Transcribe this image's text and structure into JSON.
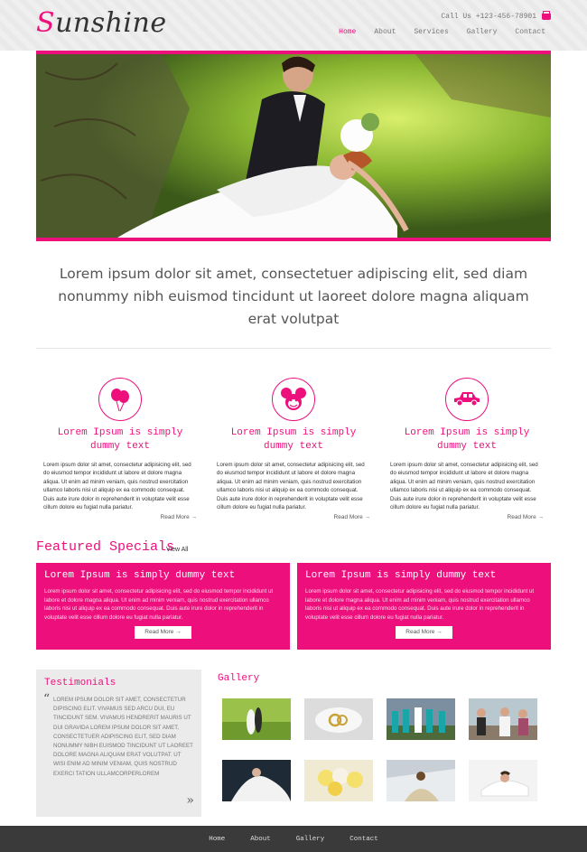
{
  "header": {
    "logo_first": "S",
    "logo_rest": "unshine",
    "call_text": "Call Us +123-456-78901",
    "nav": [
      "Home",
      "About",
      "Services",
      "Gallery",
      "Contact"
    ]
  },
  "lead": "Lorem ipsum dolor sit amet, consectetuer adipiscing elit, sed diam nonummy nibh euismod tincidunt ut laoreet dolore magna aliquam erat volutpat",
  "features": [
    {
      "icon": "balloons-icon",
      "title": "Lorem Ipsum is simply dummy text",
      "text": "Lorem ipsum dolor sit amet, consectetur adipisicing elit, sed do eiusmod tempor incididunt ut labore et dolore magna aliqua. Ut enim ad minim veniam, quis nostrud exercitation ullamco laboris nisi ut aliquip ex ea commodo consequat. Duis aute irure dolor in reprehenderit in voluptate velit esse cillum dolore eu fugiat nulla pariatur.",
      "more": "Read More →"
    },
    {
      "icon": "mouse-icon",
      "title": "Lorem Ipsum is simply dummy text",
      "text": "Lorem ipsum dolor sit amet, consectetur adipisicing elit, sed do eiusmod tempor incididunt ut labore et dolore magna aliqua. Ut enim ad minim veniam, quis nostrud exercitation ullamco laboris nisi ut aliquip ex ea commodo consequat. Duis aute irure dolor in reprehenderit in voluptate velit esse cillum dolore eu fugiat nulla pariatur.",
      "more": "Read More →"
    },
    {
      "icon": "car-icon",
      "title": "Lorem Ipsum is simply dummy text",
      "text": "Lorem ipsum dolor sit amet, consectetur adipisicing elit, sed do eiusmod tempor incididunt ut labore et dolore magna aliqua. Ut enim ad minim veniam, quis nostrud exercitation ullamco laboris nisi ut aliquip ex ea commodo consequat. Duis aute irure dolor in reprehenderit in voluptate velit esse cillum dolore eu fugiat nulla pariatur.",
      "more": "Read More →"
    }
  ],
  "featured": {
    "title": "Featured Specials",
    "view_all": "View All",
    "cards": [
      {
        "title": "Lorem Ipsum is simply dummy text",
        "text": "Lorem ipsum dolor sit amet, consectetur adipisicing elit, sed do eiusmod tempor incididunt ut labore et dolore magna aliqua. Ut enim ad minim veniam, quis nostrud exercitation ullamco laboris nisi ut aliquip ex ea commodo consequat. Duis aute irure dolor in reprehenderit in voluptate velit esse cillum dolore eu fugiat nulla pariatur.",
        "button": "Read More →"
      },
      {
        "title": "Lorem Ipsum is simply dummy text",
        "text": "Lorem ipsum dolor sit amet, consectetur adipisicing elit, sed do eiusmod tempor incididunt ut labore et dolore magna aliqua. Ut enim ad minim veniam, quis nostrud exercitation ullamco laboris nisi ut aliquip ex ea commodo consequat. Duis aute irure dolor in reprehenderit in voluptate velit esse cillum dolore eu fugiat nulla pariatur.",
        "button": "Read More →"
      }
    ]
  },
  "testimonials": {
    "title": "Testimonials",
    "open_quote": "“",
    "close_quote": "»",
    "text": "LOREM IPSUM DOLOR SIT AMET, CONSECTETUR DIPISCING ELIT. VIVAMUS SED ARCU DUI, EU TINCIDUNT SEM. VIVAMUS HENDRERIT MAURIS UT DUI GRAVIDA LOREM IPSUM DOLOR SIT AMET, CONSECTETUER ADIPISCING ELIT, SED DIAM NONUMMY NIBH EUISMOD TINCIDUNT UT LAOREET DOLORE MAGNA ALIQUAM ERAT VOLUTPAT. UT WISI ENIM AD MINIM VENIAM, QUIS NOSTRUD EXERCI TATION ULLAMCORPERLOREM"
  },
  "gallery": {
    "title": "Gallery"
  },
  "footer": {
    "nav": [
      "Home",
      "About",
      "Gallery",
      "Contact"
    ]
  },
  "colors": {
    "accent": "#ed0f7c",
    "footer_bg": "#3a3a3a",
    "testimonial_bg": "#ebebeb"
  }
}
